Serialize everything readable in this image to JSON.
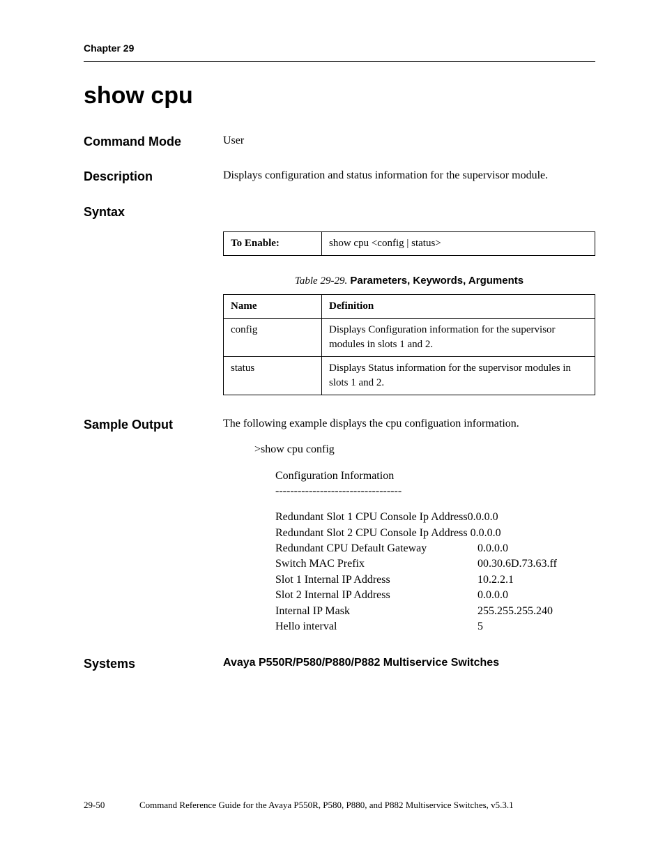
{
  "header": {
    "chapter": "Chapter 29"
  },
  "title": "show cpu",
  "sections": {
    "commandMode": {
      "label": "Command Mode",
      "value": "User"
    },
    "description": {
      "label": "Description",
      "value": "Displays configuration and status information for the supervisor module."
    },
    "syntax": {
      "label": "Syntax",
      "enableLabel": "To Enable:",
      "enableValue": "show cpu <config | status>",
      "tableCaptionPrefix": "Table 29-29.",
      "tableCaptionTitle": "Parameters, Keywords, Arguments",
      "headers": {
        "name": "Name",
        "definition": "Definition"
      },
      "rows": [
        {
          "name": "config",
          "definition": "Displays Configuration information for the supervisor modules in slots 1 and 2."
        },
        {
          "name": "status",
          "definition": "Displays Status information for the supervisor modules in slots 1 and 2."
        }
      ]
    },
    "sampleOutput": {
      "label": "Sample Output",
      "intro": "The following example displays the cpu configuation information.",
      "prompt": ">show cpu config",
      "titleLine": "Configuration Information",
      "dashLine": "----------------------------------",
      "kv": [
        {
          "key": "Redundant Slot 1 CPU Console Ip Address",
          "value": "0.0.0.0",
          "tight": true
        },
        {
          "key": "Redundant Slot 2 CPU Console Ip Address",
          "value": " 0.0.0.0",
          "tight": true
        },
        {
          "key": "Redundant CPU Default Gateway",
          "value": "0.0.0.0"
        },
        {
          "key": "Switch MAC Prefix",
          "value": "00.30.6D.73.63.ff"
        },
        {
          "key": "Slot 1 Internal IP Address",
          "value": "10.2.2.1"
        },
        {
          "key": "Slot 2 Internal IP Address",
          "value": "0.0.0.0"
        },
        {
          "key": "Internal IP Mask",
          "value": "255.255.255.240"
        },
        {
          "key": "Hello interval",
          "value": "5"
        }
      ]
    },
    "systems": {
      "label": "Systems",
      "value": "Avaya P550R/P580/P880/P882 Multiservice Switches"
    }
  },
  "footer": {
    "pageNum": "29-50",
    "text": "Command Reference Guide for the Avaya P550R, P580, P880, and P882 Multiservice Switches, v5.3.1"
  }
}
